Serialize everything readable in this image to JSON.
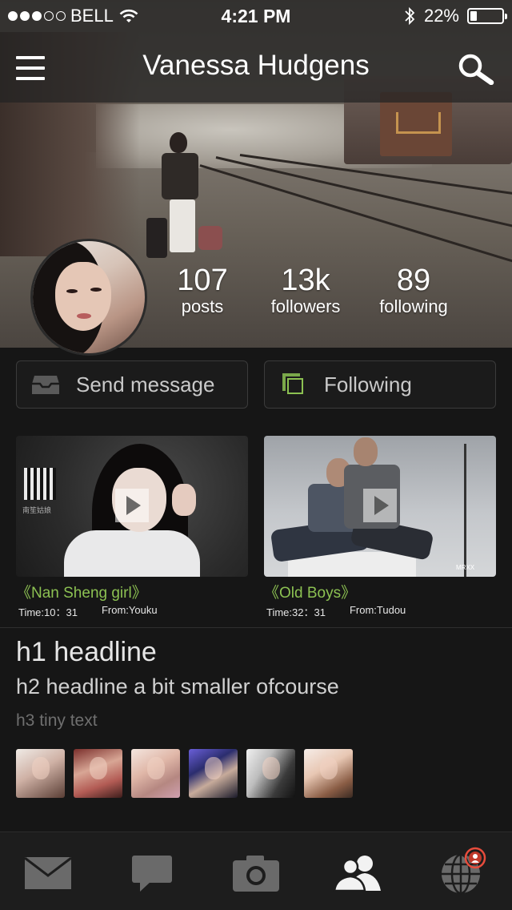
{
  "status_bar": {
    "carrier": "BELL",
    "time": "4:21 PM",
    "battery": "22%",
    "battery_level": 0.22,
    "signal_bars_filled": 3,
    "signal_bars_total": 5
  },
  "header": {
    "title": "Vanessa Hudgens",
    "menu_icon": "hamburger-menu-icon",
    "search_icon": "search-icon"
  },
  "profile": {
    "stats": [
      {
        "value": "107",
        "label": "posts"
      },
      {
        "value": "13k",
        "label": "followers"
      },
      {
        "value": "89",
        "label": "following"
      }
    ]
  },
  "actions": {
    "send_message": "Send message",
    "following": "Following",
    "following_accent": "#8cc152"
  },
  "videos": [
    {
      "title": "《Nan Sheng girl》",
      "time": "Time:10：31",
      "from": "From:Youku",
      "qr_caption": "南笙姑娘"
    },
    {
      "title": "《Old Boys》",
      "time": "Time:32：31",
      "from": "From:Tudou",
      "watermark": "MRXX"
    }
  ],
  "content": {
    "h1": "h1 headline",
    "h2": "h2 headline a bit smaller ofcourse",
    "h3": "h3 tiny text"
  },
  "tabbar": {
    "items": [
      "mail-icon",
      "chat-icon",
      "camera-icon",
      "people-icon",
      "globe-icon"
    ],
    "active": "people-icon",
    "badge_color": "#e74c3c"
  }
}
